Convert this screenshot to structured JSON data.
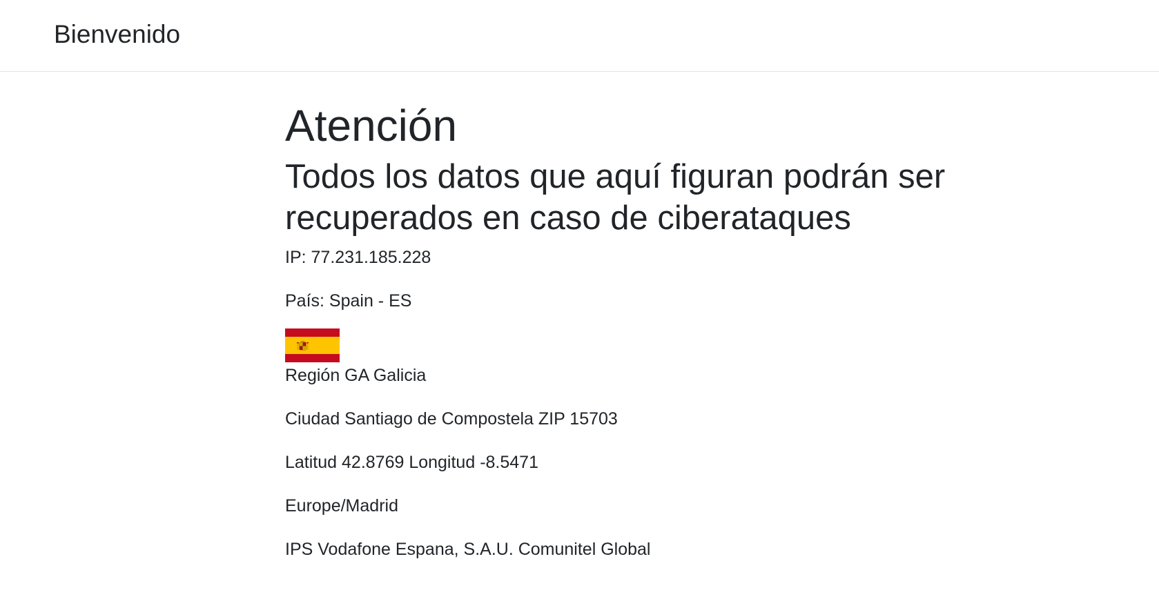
{
  "navbar": {
    "brand": "Bienvenido"
  },
  "main": {
    "title": "Atención",
    "subtitle": "Todos los datos que aquí figuran podrán ser recuperados en caso de ciberataques",
    "ip": "IP: 77.231.185.228",
    "country": "País: Spain - ES",
    "flag_icon": "spain-flag-icon",
    "region": "Región GA Galicia",
    "city": "Ciudad Santiago de Compostela ZIP 15703",
    "coordinates": "Latitud 42.8769 Longitud -8.5471",
    "timezone": "Europe/Madrid",
    "isp": "IPS Vodafone Espana, S.A.U. Comunitel Global"
  },
  "colors": {
    "text": "#212529",
    "flag_red": "#c60b1e",
    "flag_yellow": "#ffc400",
    "divider": "#e5e5e5"
  }
}
